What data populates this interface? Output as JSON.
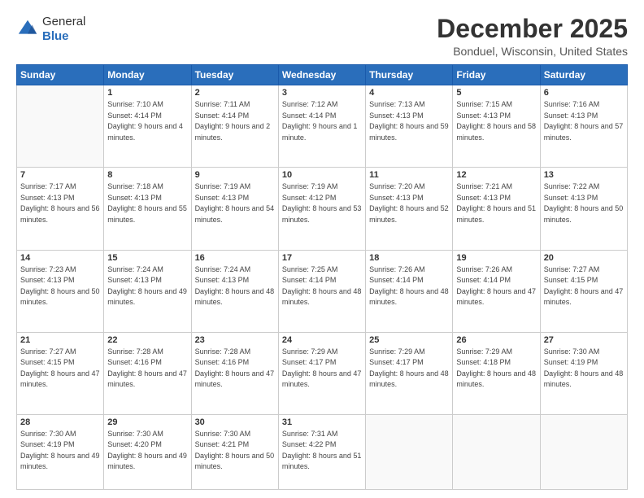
{
  "header": {
    "logo_general": "General",
    "logo_blue": "Blue",
    "month_title": "December 2025",
    "location": "Bonduel, Wisconsin, United States"
  },
  "weekdays": [
    "Sunday",
    "Monday",
    "Tuesday",
    "Wednesday",
    "Thursday",
    "Friday",
    "Saturday"
  ],
  "weeks": [
    [
      {
        "day": "",
        "sunrise": "",
        "sunset": "",
        "daylight": ""
      },
      {
        "day": "1",
        "sunrise": "Sunrise: 7:10 AM",
        "sunset": "Sunset: 4:14 PM",
        "daylight": "Daylight: 9 hours and 4 minutes."
      },
      {
        "day": "2",
        "sunrise": "Sunrise: 7:11 AM",
        "sunset": "Sunset: 4:14 PM",
        "daylight": "Daylight: 9 hours and 2 minutes."
      },
      {
        "day": "3",
        "sunrise": "Sunrise: 7:12 AM",
        "sunset": "Sunset: 4:14 PM",
        "daylight": "Daylight: 9 hours and 1 minute."
      },
      {
        "day": "4",
        "sunrise": "Sunrise: 7:13 AM",
        "sunset": "Sunset: 4:13 PM",
        "daylight": "Daylight: 8 hours and 59 minutes."
      },
      {
        "day": "5",
        "sunrise": "Sunrise: 7:15 AM",
        "sunset": "Sunset: 4:13 PM",
        "daylight": "Daylight: 8 hours and 58 minutes."
      },
      {
        "day": "6",
        "sunrise": "Sunrise: 7:16 AM",
        "sunset": "Sunset: 4:13 PM",
        "daylight": "Daylight: 8 hours and 57 minutes."
      }
    ],
    [
      {
        "day": "7",
        "sunrise": "Sunrise: 7:17 AM",
        "sunset": "Sunset: 4:13 PM",
        "daylight": "Daylight: 8 hours and 56 minutes."
      },
      {
        "day": "8",
        "sunrise": "Sunrise: 7:18 AM",
        "sunset": "Sunset: 4:13 PM",
        "daylight": "Daylight: 8 hours and 55 minutes."
      },
      {
        "day": "9",
        "sunrise": "Sunrise: 7:19 AM",
        "sunset": "Sunset: 4:13 PM",
        "daylight": "Daylight: 8 hours and 54 minutes."
      },
      {
        "day": "10",
        "sunrise": "Sunrise: 7:19 AM",
        "sunset": "Sunset: 4:12 PM",
        "daylight": "Daylight: 8 hours and 53 minutes."
      },
      {
        "day": "11",
        "sunrise": "Sunrise: 7:20 AM",
        "sunset": "Sunset: 4:13 PM",
        "daylight": "Daylight: 8 hours and 52 minutes."
      },
      {
        "day": "12",
        "sunrise": "Sunrise: 7:21 AM",
        "sunset": "Sunset: 4:13 PM",
        "daylight": "Daylight: 8 hours and 51 minutes."
      },
      {
        "day": "13",
        "sunrise": "Sunrise: 7:22 AM",
        "sunset": "Sunset: 4:13 PM",
        "daylight": "Daylight: 8 hours and 50 minutes."
      }
    ],
    [
      {
        "day": "14",
        "sunrise": "Sunrise: 7:23 AM",
        "sunset": "Sunset: 4:13 PM",
        "daylight": "Daylight: 8 hours and 50 minutes."
      },
      {
        "day": "15",
        "sunrise": "Sunrise: 7:24 AM",
        "sunset": "Sunset: 4:13 PM",
        "daylight": "Daylight: 8 hours and 49 minutes."
      },
      {
        "day": "16",
        "sunrise": "Sunrise: 7:24 AM",
        "sunset": "Sunset: 4:13 PM",
        "daylight": "Daylight: 8 hours and 48 minutes."
      },
      {
        "day": "17",
        "sunrise": "Sunrise: 7:25 AM",
        "sunset": "Sunset: 4:14 PM",
        "daylight": "Daylight: 8 hours and 48 minutes."
      },
      {
        "day": "18",
        "sunrise": "Sunrise: 7:26 AM",
        "sunset": "Sunset: 4:14 PM",
        "daylight": "Daylight: 8 hours and 48 minutes."
      },
      {
        "day": "19",
        "sunrise": "Sunrise: 7:26 AM",
        "sunset": "Sunset: 4:14 PM",
        "daylight": "Daylight: 8 hours and 47 minutes."
      },
      {
        "day": "20",
        "sunrise": "Sunrise: 7:27 AM",
        "sunset": "Sunset: 4:15 PM",
        "daylight": "Daylight: 8 hours and 47 minutes."
      }
    ],
    [
      {
        "day": "21",
        "sunrise": "Sunrise: 7:27 AM",
        "sunset": "Sunset: 4:15 PM",
        "daylight": "Daylight: 8 hours and 47 minutes."
      },
      {
        "day": "22",
        "sunrise": "Sunrise: 7:28 AM",
        "sunset": "Sunset: 4:16 PM",
        "daylight": "Daylight: 8 hours and 47 minutes."
      },
      {
        "day": "23",
        "sunrise": "Sunrise: 7:28 AM",
        "sunset": "Sunset: 4:16 PM",
        "daylight": "Daylight: 8 hours and 47 minutes."
      },
      {
        "day": "24",
        "sunrise": "Sunrise: 7:29 AM",
        "sunset": "Sunset: 4:17 PM",
        "daylight": "Daylight: 8 hours and 47 minutes."
      },
      {
        "day": "25",
        "sunrise": "Sunrise: 7:29 AM",
        "sunset": "Sunset: 4:17 PM",
        "daylight": "Daylight: 8 hours and 48 minutes."
      },
      {
        "day": "26",
        "sunrise": "Sunrise: 7:29 AM",
        "sunset": "Sunset: 4:18 PM",
        "daylight": "Daylight: 8 hours and 48 minutes."
      },
      {
        "day": "27",
        "sunrise": "Sunrise: 7:30 AM",
        "sunset": "Sunset: 4:19 PM",
        "daylight": "Daylight: 8 hours and 48 minutes."
      }
    ],
    [
      {
        "day": "28",
        "sunrise": "Sunrise: 7:30 AM",
        "sunset": "Sunset: 4:19 PM",
        "daylight": "Daylight: 8 hours and 49 minutes."
      },
      {
        "day": "29",
        "sunrise": "Sunrise: 7:30 AM",
        "sunset": "Sunset: 4:20 PM",
        "daylight": "Daylight: 8 hours and 49 minutes."
      },
      {
        "day": "30",
        "sunrise": "Sunrise: 7:30 AM",
        "sunset": "Sunset: 4:21 PM",
        "daylight": "Daylight: 8 hours and 50 minutes."
      },
      {
        "day": "31",
        "sunrise": "Sunrise: 7:31 AM",
        "sunset": "Sunset: 4:22 PM",
        "daylight": "Daylight: 8 hours and 51 minutes."
      },
      {
        "day": "",
        "sunrise": "",
        "sunset": "",
        "daylight": ""
      },
      {
        "day": "",
        "sunrise": "",
        "sunset": "",
        "daylight": ""
      },
      {
        "day": "",
        "sunrise": "",
        "sunset": "",
        "daylight": ""
      }
    ]
  ]
}
